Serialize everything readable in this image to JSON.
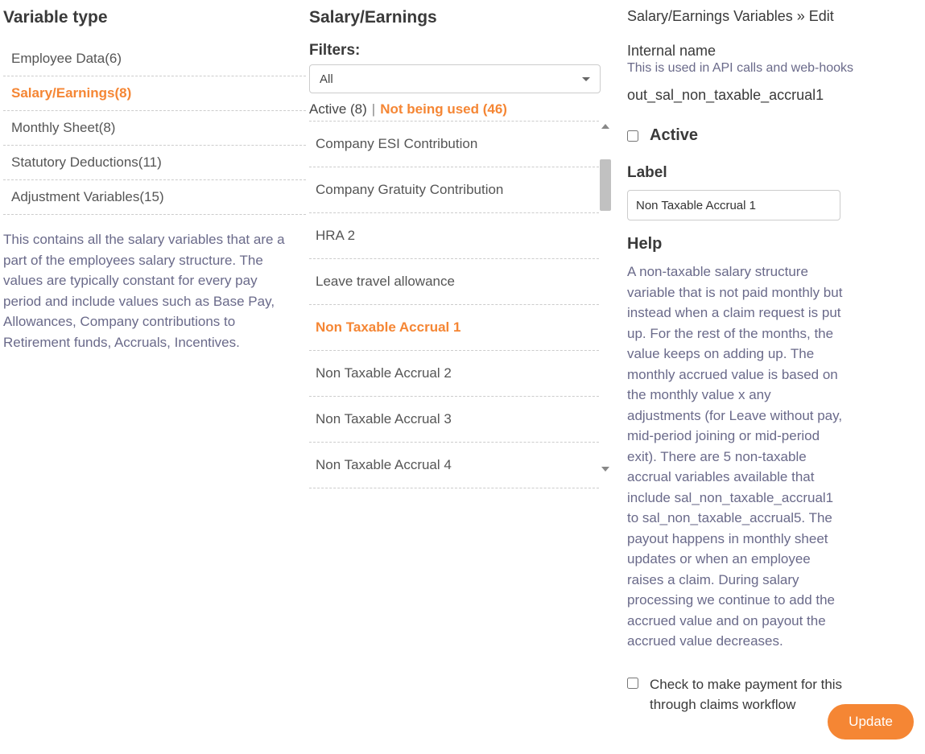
{
  "left": {
    "title": "Variable type",
    "types": [
      {
        "label": "Employee Data(6)",
        "active": false
      },
      {
        "label": "Salary/Earnings(8)",
        "active": true
      },
      {
        "label": "Monthly Sheet(8)",
        "active": false
      },
      {
        "label": "Statutory Deductions(11)",
        "active": false
      },
      {
        "label": "Adjustment Variables(15)",
        "active": false
      }
    ],
    "description": "This contains all the salary variables that are a part of the employees salary structure. The values are typically constant for every pay period and include values such as Base Pay, Allowances, Company contributions to Retirement funds, Accruals, Incentives."
  },
  "mid": {
    "title": "Salary/Earnings",
    "filters_label": "Filters:",
    "filter_selected": "All",
    "tabs": {
      "active_text": "Active (8)",
      "separator": "|",
      "not_used_text": "Not being used (46)"
    },
    "variables": [
      {
        "label": "Company ESI Contribution",
        "selected": false
      },
      {
        "label": "Company Gratuity Contribution",
        "selected": false
      },
      {
        "label": "HRA 2",
        "selected": false
      },
      {
        "label": "Leave travel allowance",
        "selected": false
      },
      {
        "label": "Non Taxable Accrual 1",
        "selected": true
      },
      {
        "label": "Non Taxable Accrual 2",
        "selected": false
      },
      {
        "label": "Non Taxable Accrual 3",
        "selected": false
      },
      {
        "label": "Non Taxable Accrual 4",
        "selected": false
      }
    ]
  },
  "right": {
    "breadcrumb": "Salary/Earnings Variables » Edit",
    "internal_name": {
      "label": "Internal name",
      "hint": "This is used in API calls and web-hooks",
      "value": "out_sal_non_taxable_accrual1"
    },
    "active_checkbox": {
      "checked": false,
      "label": "Active"
    },
    "label_field": {
      "heading": "Label",
      "value": "Non Taxable Accrual 1"
    },
    "help": {
      "heading": "Help",
      "text": "A non-taxable salary structure variable that is not paid monthly but instead when a claim request is put up. For the rest of the months, the value keeps on adding up. The monthly accrued value is based on the monthly value x any adjustments (for Leave without pay, mid-period joining or mid-period exit). There are 5 non-taxable accrual variables available that include sal_non_taxable_accrual1 to sal_non_taxable_accrual5. The payout happens in monthly sheet updates or when an employee raises a claim. During salary processing we continue to add the accrued value and on payout the accrued value decreases."
    },
    "claims_checkbox": {
      "checked": false,
      "label": "Check to make payment for this through claims workflow"
    },
    "update_button": "Update"
  }
}
